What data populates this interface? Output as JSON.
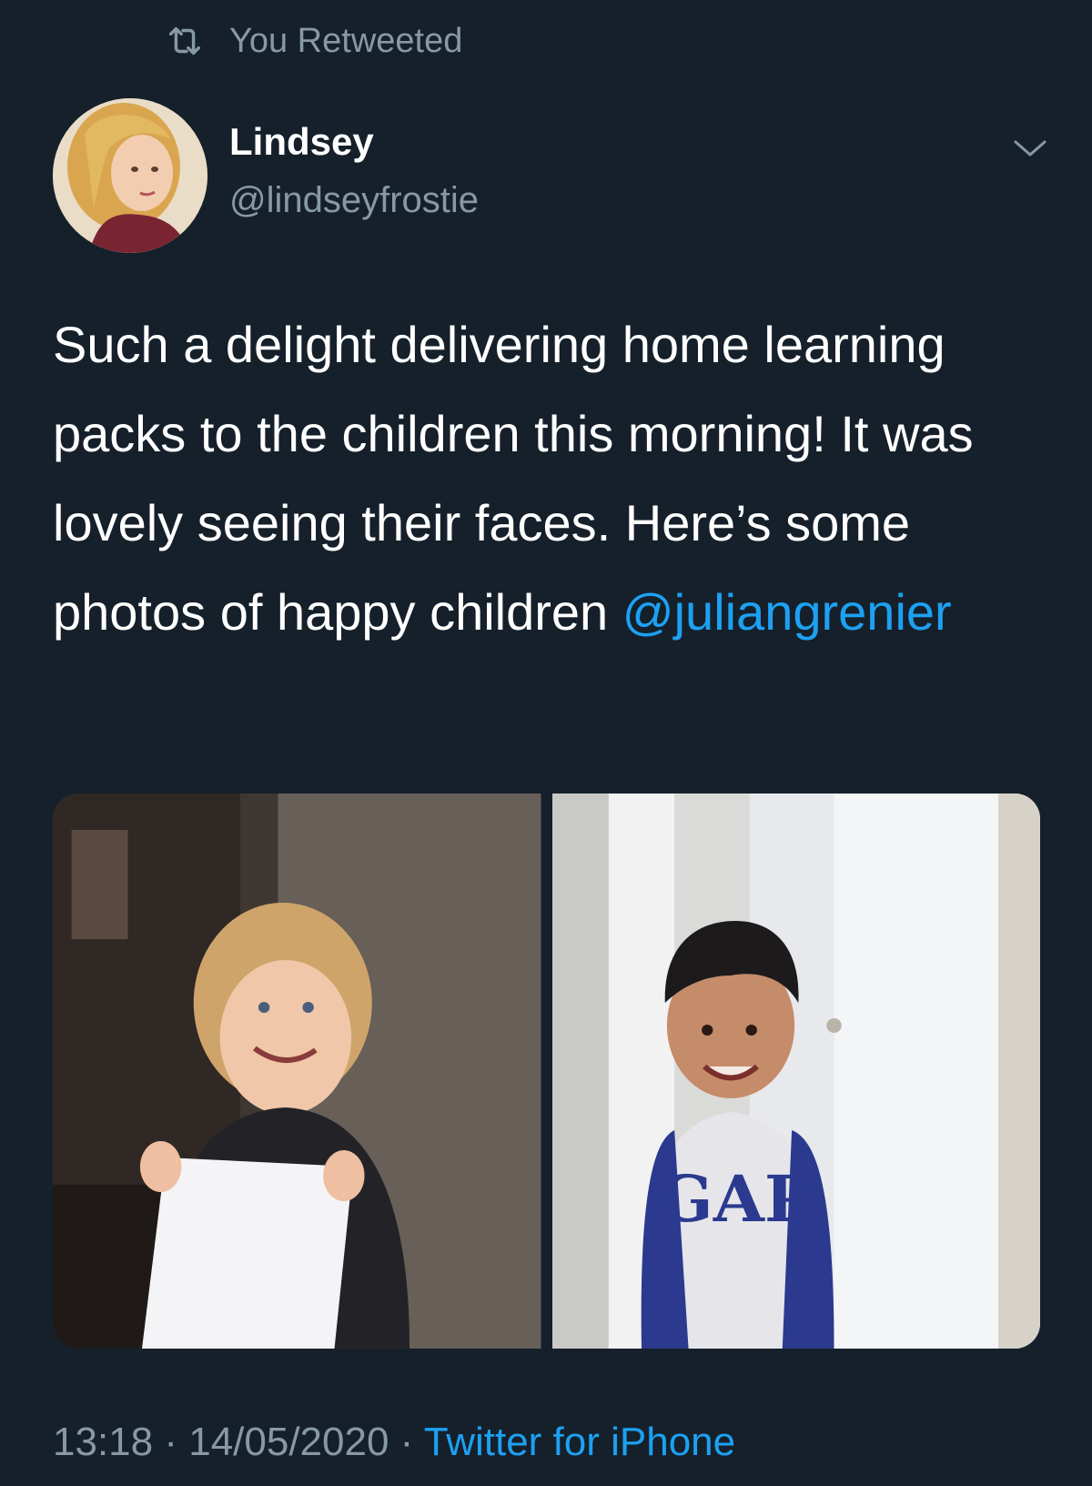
{
  "retweet": {
    "label": "You Retweeted",
    "icon": "retweet-icon"
  },
  "author": {
    "display_name": "Lindsey",
    "handle": "@lindseyfrostie"
  },
  "tweet": {
    "text": "Such a delight delivering home learning packs to the children this morning! It was lovely seeing their faces. Here’s some photos of happy children ",
    "mention": "@juliangrenier"
  },
  "meta": {
    "time": "13:18",
    "separator1": " · ",
    "date": "14/05/2020",
    "separator2": " · ",
    "client": "Twitter for iPhone"
  },
  "colors": {
    "background": "#15202b",
    "secondary_text": "#8899a6",
    "accent": "#1da1f2"
  }
}
